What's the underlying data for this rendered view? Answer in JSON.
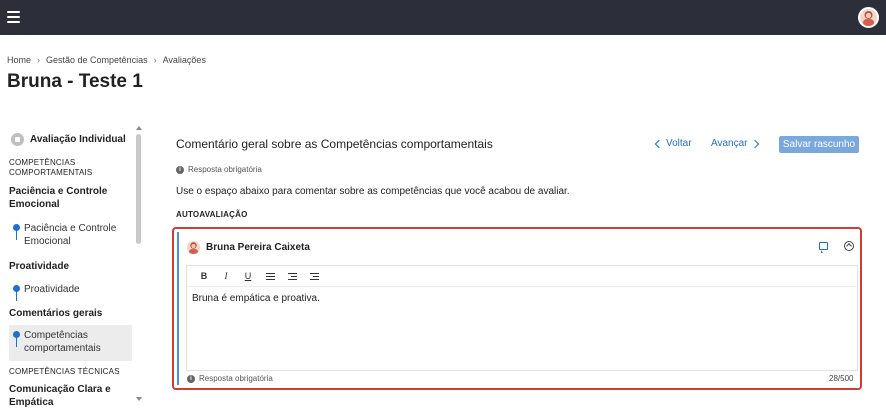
{
  "topbar": {
    "menu_icon": "hamburger-icon",
    "avatar": "user-avatar"
  },
  "breadcrumb": [
    "Home",
    "Gestão de Competências",
    "Avaliações"
  ],
  "page_title": "Bruna - Teste 1",
  "sidebar": {
    "header": "Avaliação Individual",
    "cat_comportamentais": "COMPETÊNCIAS COMPORTAMENTAIS",
    "group_paciencia": "Paciência e Controle Emocional",
    "sub_paciencia": "Paciência e Controle Emocional",
    "group_proatividade": "Proatividade",
    "sub_proatividade": "Proatividade",
    "group_comentarios": "Comentários gerais",
    "sub_comentarios": "Competências comportamentais",
    "cat_tecnicas": "COMPETÊNCIAS TÉCNICAS",
    "group_comunicacao": "Comunicação Clara e Empática"
  },
  "main": {
    "title": "Comentário geral sobre as Competências comportamentais",
    "back_label": "Voltar",
    "next_label": "Avançar",
    "save_label": "Salvar rascunho",
    "required_note": "Resposta obrigatória",
    "description": "Use o espaço abaixo para comentar sobre as competências que você acabou de avaliar.",
    "section_label": "AUTOAVALIAÇÃO",
    "card": {
      "author": "Bruna Pereira Caixeta",
      "toolbar": {
        "bold": "B",
        "italic": "I",
        "underline": "U"
      },
      "text": "Bruna é empática e proativa.",
      "footer_note": "Resposta obrigatória",
      "counter": "28/500"
    }
  },
  "colors": {
    "accent": "#1e6fd0",
    "topbar": "#2c2f3a",
    "error_border": "#d13b36",
    "save_button": "#7aa7de"
  }
}
